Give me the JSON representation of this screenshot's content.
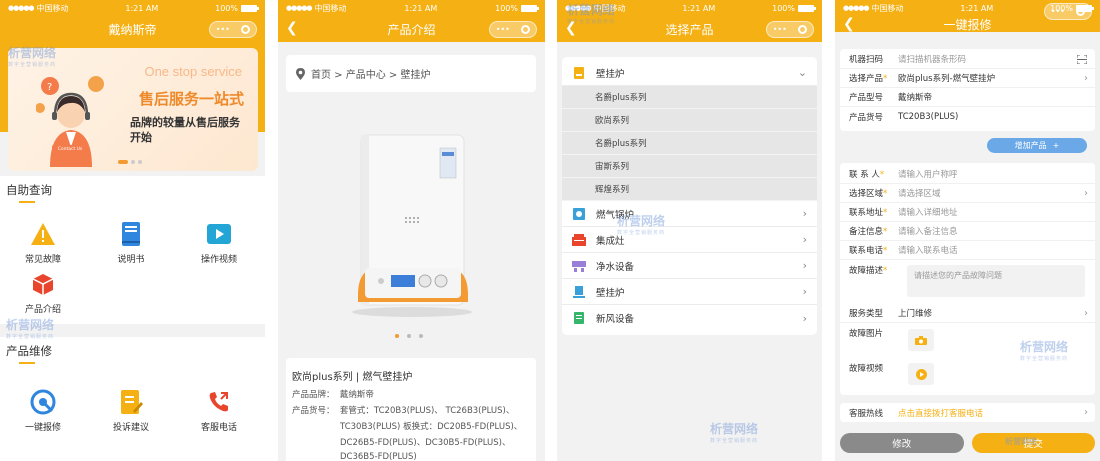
{
  "status": {
    "carrier": "中国移动",
    "time": "1:21 AM",
    "battery": "100%"
  },
  "watermark": {
    "brand": "析营网络",
    "tagline": "数字全营销服务商"
  },
  "screen1": {
    "title": "戴纳斯帝",
    "banner": {
      "en": "One stop service",
      "headline": "售后服务一站式",
      "sub": "品牌的较量从售后服务开始",
      "btn": "Contact Us"
    },
    "section1": {
      "title": "自助查询",
      "items": [
        "常见故障",
        "说明书",
        "操作视频",
        "产品介绍"
      ]
    },
    "section2": {
      "title": "产品维修",
      "items": [
        "一键报修",
        "投诉建议",
        "客服电话"
      ]
    }
  },
  "screen2": {
    "title": "产品介绍",
    "breadcrumb": "首页 > 产品中心 > 壁挂炉",
    "product_title": "欧尚plus系列 | 燃气壁挂炉",
    "brand_label": "产品品牌：",
    "brand": "戴纳斯帝",
    "model_label": "产品货号：",
    "models_line1": "套管式：TC20B3(PLUS)、 TC26B3(PLUS)、",
    "models_line2": "TC30B3(PLUS)  板换式：DC20B5-FD(PLUS)、",
    "models_line3": "DC26B5-FD(PLUS)、DC30B5-FD(PLUS)、",
    "models_line4": "DC36B5-FD(PLUS)"
  },
  "screen3": {
    "title": "选择产品",
    "expanded": "壁挂炉",
    "subitems": [
      "名爵plus系列",
      "欧尚系列",
      "名爵plus系列",
      "宙斯系列",
      "辉煌系列"
    ],
    "categories": [
      "燃气锅炉",
      "集成灶",
      "净水设备",
      "壁挂炉",
      "新风设备"
    ]
  },
  "screen4": {
    "title": "一键报修",
    "scan": {
      "label": "机器扫码",
      "placeholder": "请扫描机器条形码"
    },
    "product": {
      "label": "选择产品",
      "value": "欧尚plus系列-燃气壁挂炉"
    },
    "model": {
      "label": "产品型号",
      "value": "戴纳斯帝"
    },
    "sku": {
      "label": "产品货号",
      "value": "TC20B3(PLUS)"
    },
    "add_btn": "增加产品",
    "contact": {
      "label": "联 系 人",
      "placeholder": "请输入用户称呼"
    },
    "region": {
      "label": "选择区域",
      "placeholder": "请选择区域"
    },
    "address": {
      "label": "联系地址",
      "placeholder": "请输入详细地址"
    },
    "note": {
      "label": "备注信息",
      "placeholder": "请输入备注信息"
    },
    "phone": {
      "label": "联系电话",
      "placeholder": "请输入联系电话"
    },
    "desc": {
      "label": "故障描述",
      "placeholder": "请描述您的产品故障问题"
    },
    "service": {
      "label": "服务类型",
      "value": "上门维修"
    },
    "photo": {
      "label": "故障图片"
    },
    "video": {
      "label": "故障视频"
    },
    "hotline": {
      "label": "客服热线",
      "value": "点击直接拨打客服电话"
    },
    "edit_btn": "修改",
    "submit_btn": "提交"
  }
}
